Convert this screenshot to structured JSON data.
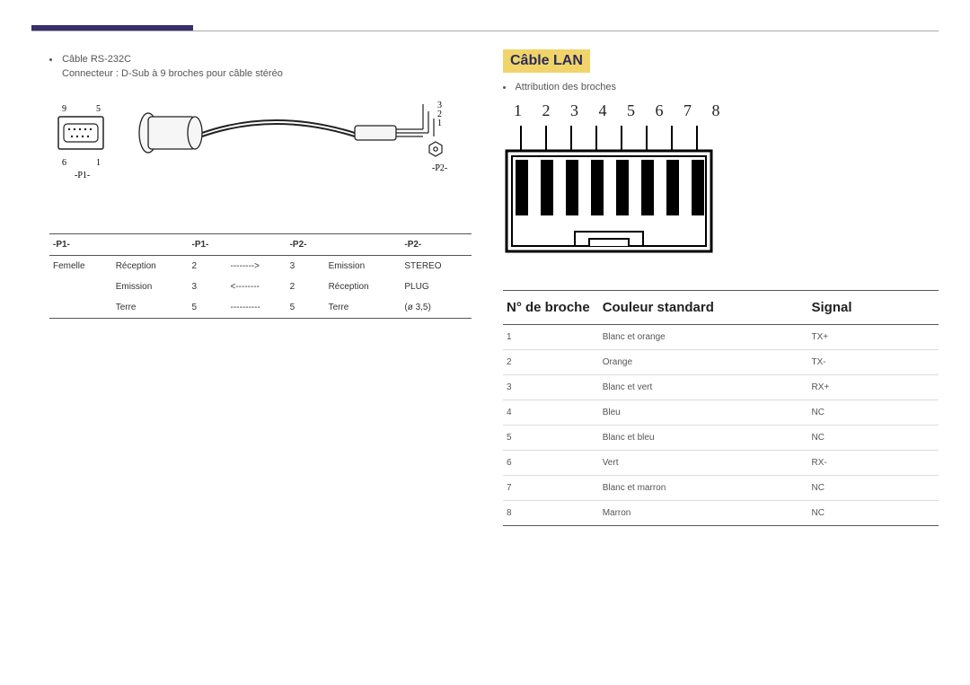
{
  "left": {
    "bullet": "Câble RS-232C",
    "connector_line": "Connecteur : D-Sub à 9 broches pour câble stéréo",
    "diagram_labels": {
      "top_left_l": "9",
      "top_left_r": "5",
      "bot_left_l": "6",
      "bot_left_r": "1",
      "p1": "-P1-",
      "p2": "-P2-",
      "j3": "3",
      "j2": "2",
      "j1": "1"
    },
    "table": {
      "headers": [
        "-P1-",
        "",
        "-P1-",
        "",
        "-P2-",
        "",
        "-P2-"
      ],
      "rows": [
        [
          "Femelle",
          "Réception",
          "2",
          "-------->",
          "3",
          "Emission",
          "STEREO"
        ],
        [
          "",
          "Emission",
          "3",
          "<--------",
          "2",
          "Réception",
          "PLUG"
        ],
        [
          "",
          "Terre",
          "5",
          "----------",
          "5",
          "Terre",
          "(ø 3,5)"
        ]
      ]
    }
  },
  "right": {
    "heading": "Câble LAN",
    "bullet": "Attribution des broches",
    "pin_row": "1   2   3   4   5   6   7   8",
    "table": {
      "headers": [
        "N° de broche",
        "Couleur standard",
        "Signal"
      ],
      "rows": [
        [
          "1",
          "Blanc et orange",
          "TX+"
        ],
        [
          "2",
          "Orange",
          "TX-"
        ],
        [
          "3",
          "Blanc et vert",
          "RX+"
        ],
        [
          "4",
          "Bleu",
          "NC"
        ],
        [
          "5",
          "Blanc et bleu",
          "NC"
        ],
        [
          "6",
          "Vert",
          "RX-"
        ],
        [
          "7",
          "Blanc et marron",
          "NC"
        ],
        [
          "8",
          "Marron",
          "NC"
        ]
      ]
    }
  }
}
